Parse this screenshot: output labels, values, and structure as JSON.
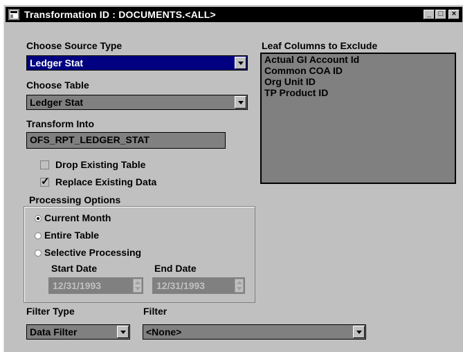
{
  "window": {
    "title": "Transformation ID : DOCUMENTS.<ALL>",
    "controls": [
      "_",
      "□",
      "×"
    ]
  },
  "source_type": {
    "label": "Choose Source Type",
    "value": "Ledger Stat"
  },
  "table": {
    "label": "Choose Table",
    "value": "Ledger Stat"
  },
  "transform_into": {
    "label": "Transform Into",
    "value": "OFS_RPT_LEDGER_STAT"
  },
  "drop_existing": {
    "label": "Drop Existing Table",
    "checked": false
  },
  "replace_existing": {
    "label": "Replace Existing Data",
    "checked": true
  },
  "processing": {
    "label": "Processing Options",
    "options": [
      {
        "label": "Current Month",
        "selected": true
      },
      {
        "label": "Entire Table",
        "selected": false
      },
      {
        "label": "Selective Processing",
        "selected": false
      }
    ],
    "start_date_label": "Start Date",
    "start_date": "12/31/1993",
    "end_date_label": "End Date",
    "end_date": "12/31/1993"
  },
  "leaf_columns": {
    "label": "Leaf Columns to Exclude",
    "items": [
      "Actual GI Account Id",
      "Common COA ID",
      "Org Unit ID",
      "TP Product ID"
    ]
  },
  "filter_type": {
    "label": "Filter Type",
    "value": "Data Filter"
  },
  "filter": {
    "label": "Filter",
    "value": "<None>"
  }
}
